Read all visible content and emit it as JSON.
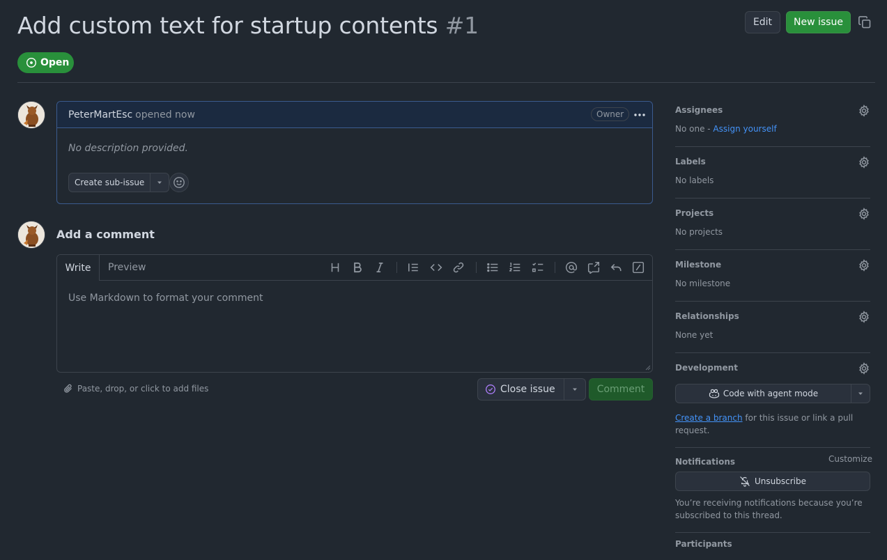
{
  "issue": {
    "title": "Add custom text for startup contents",
    "number": "#1",
    "state": "Open"
  },
  "header": {
    "edit_label": "Edit",
    "new_issue_label": "New issue"
  },
  "body": {
    "author": "PeterMartEsc",
    "opened": "opened now",
    "role_badge": "Owner",
    "description": "No description provided.",
    "sub_issue_label": "Create sub-issue"
  },
  "comment": {
    "heading": "Add a comment",
    "tab_write": "Write",
    "tab_preview": "Preview",
    "placeholder": "Use Markdown to format your comment",
    "attach_hint": "Paste, drop, or click to add files",
    "close_issue_label": "Close issue",
    "comment_label": "Comment"
  },
  "sidebar": {
    "assignees": {
      "title": "Assignees",
      "value_prefix": "No one - ",
      "link": "Assign yourself"
    },
    "labels": {
      "title": "Labels",
      "value": "No labels"
    },
    "projects": {
      "title": "Projects",
      "value": "No projects"
    },
    "milestone": {
      "title": "Milestone",
      "value": "No milestone"
    },
    "relationships": {
      "title": "Relationships",
      "value": "None yet"
    },
    "development": {
      "title": "Development",
      "agent_button": "Code with agent mode",
      "link": "Create a branch",
      "text": " for this issue or link a pull request."
    },
    "notifications": {
      "title": "Notifications",
      "customize": "Customize",
      "unsubscribe_label": "Unsubscribe",
      "text": "You’re receiving notifications because you’re subscribed to this thread."
    },
    "participants": {
      "title": "Participants"
    }
  },
  "colors": {
    "background": "#212830",
    "accent_green": "#29903b",
    "link_blue": "#4493f8",
    "border": "#3d444d",
    "highlight_border": "#3b5b8f"
  }
}
